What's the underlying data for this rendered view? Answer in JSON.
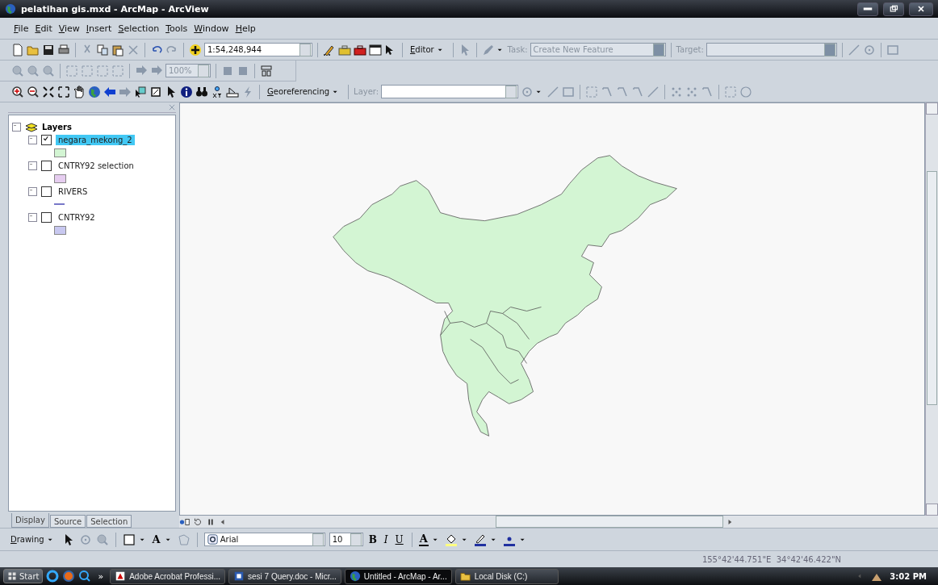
{
  "window": {
    "title": "pelatihan gis.mxd - ArcMap - ArcView"
  },
  "menu": [
    {
      "label": "File"
    },
    {
      "label": "Edit"
    },
    {
      "label": "View"
    },
    {
      "label": "Insert"
    },
    {
      "label": "Selection"
    },
    {
      "label": "Tools"
    },
    {
      "label": "Window"
    },
    {
      "label": "Help"
    }
  ],
  "standard_toolbar": {
    "scale": "1:54,248,944",
    "editor_menu": "Editor",
    "task_label": "Task:",
    "task": "Create New Feature",
    "target_label": "Target:",
    "editing_disabled": true
  },
  "layout_toolbar": {
    "zoom_percent": "100%",
    "disabled": true
  },
  "tools_toolbar": {
    "georeferencing_menu": "Georeferencing",
    "layer_label": "Layer:"
  },
  "toc": {
    "root": {
      "label": "Layers",
      "expanded": true,
      "children": [
        {
          "label": "negara_mekong_2",
          "checked": true,
          "selected": true,
          "expanded": true,
          "symbol": {
            "kind": "fill",
            "color": "#d3f5d3"
          }
        },
        {
          "label": "CNTRY92 selection",
          "checked": false,
          "selected": false,
          "expanded": true,
          "symbol": {
            "kind": "fill",
            "color": "#e6cdf0"
          }
        },
        {
          "label": "RIVERS",
          "checked": false,
          "selected": false,
          "expanded": true,
          "symbol": {
            "kind": "line",
            "color": "#7878c8"
          }
        },
        {
          "label": "CNTRY92",
          "checked": false,
          "selected": false,
          "expanded": true,
          "symbol": {
            "kind": "fill",
            "color": "#c8c8f0"
          }
        }
      ]
    }
  },
  "toc_tabs": [
    {
      "label": "Display",
      "selected": true
    },
    {
      "label": "Source",
      "selected": false
    },
    {
      "label": "Selection",
      "selected": false
    }
  ],
  "drawing_toolbar": {
    "menu": "Drawing",
    "text_tool": "A",
    "font": "Arial",
    "size": "10",
    "styles": [
      "B",
      "I",
      "U"
    ],
    "font_color": "A"
  },
  "status_bar": {
    "coordinates": "155°42'44.751\"E  34°42'46.422\"N"
  },
  "taskbar": {
    "start": "Start",
    "more": "»",
    "tasks": [
      {
        "label": "Adobe Acrobat Professi...",
        "active": false,
        "kind": "pdf"
      },
      {
        "label": "sesi 7 Query.doc - Micr...",
        "active": false,
        "kind": "doc"
      },
      {
        "label": "Untitled - ArcMap - Ar...",
        "active": true,
        "kind": "globe"
      },
      {
        "label": "Local Disk (C:)",
        "active": false,
        "kind": "folder"
      }
    ],
    "clock": "3:02 PM"
  }
}
